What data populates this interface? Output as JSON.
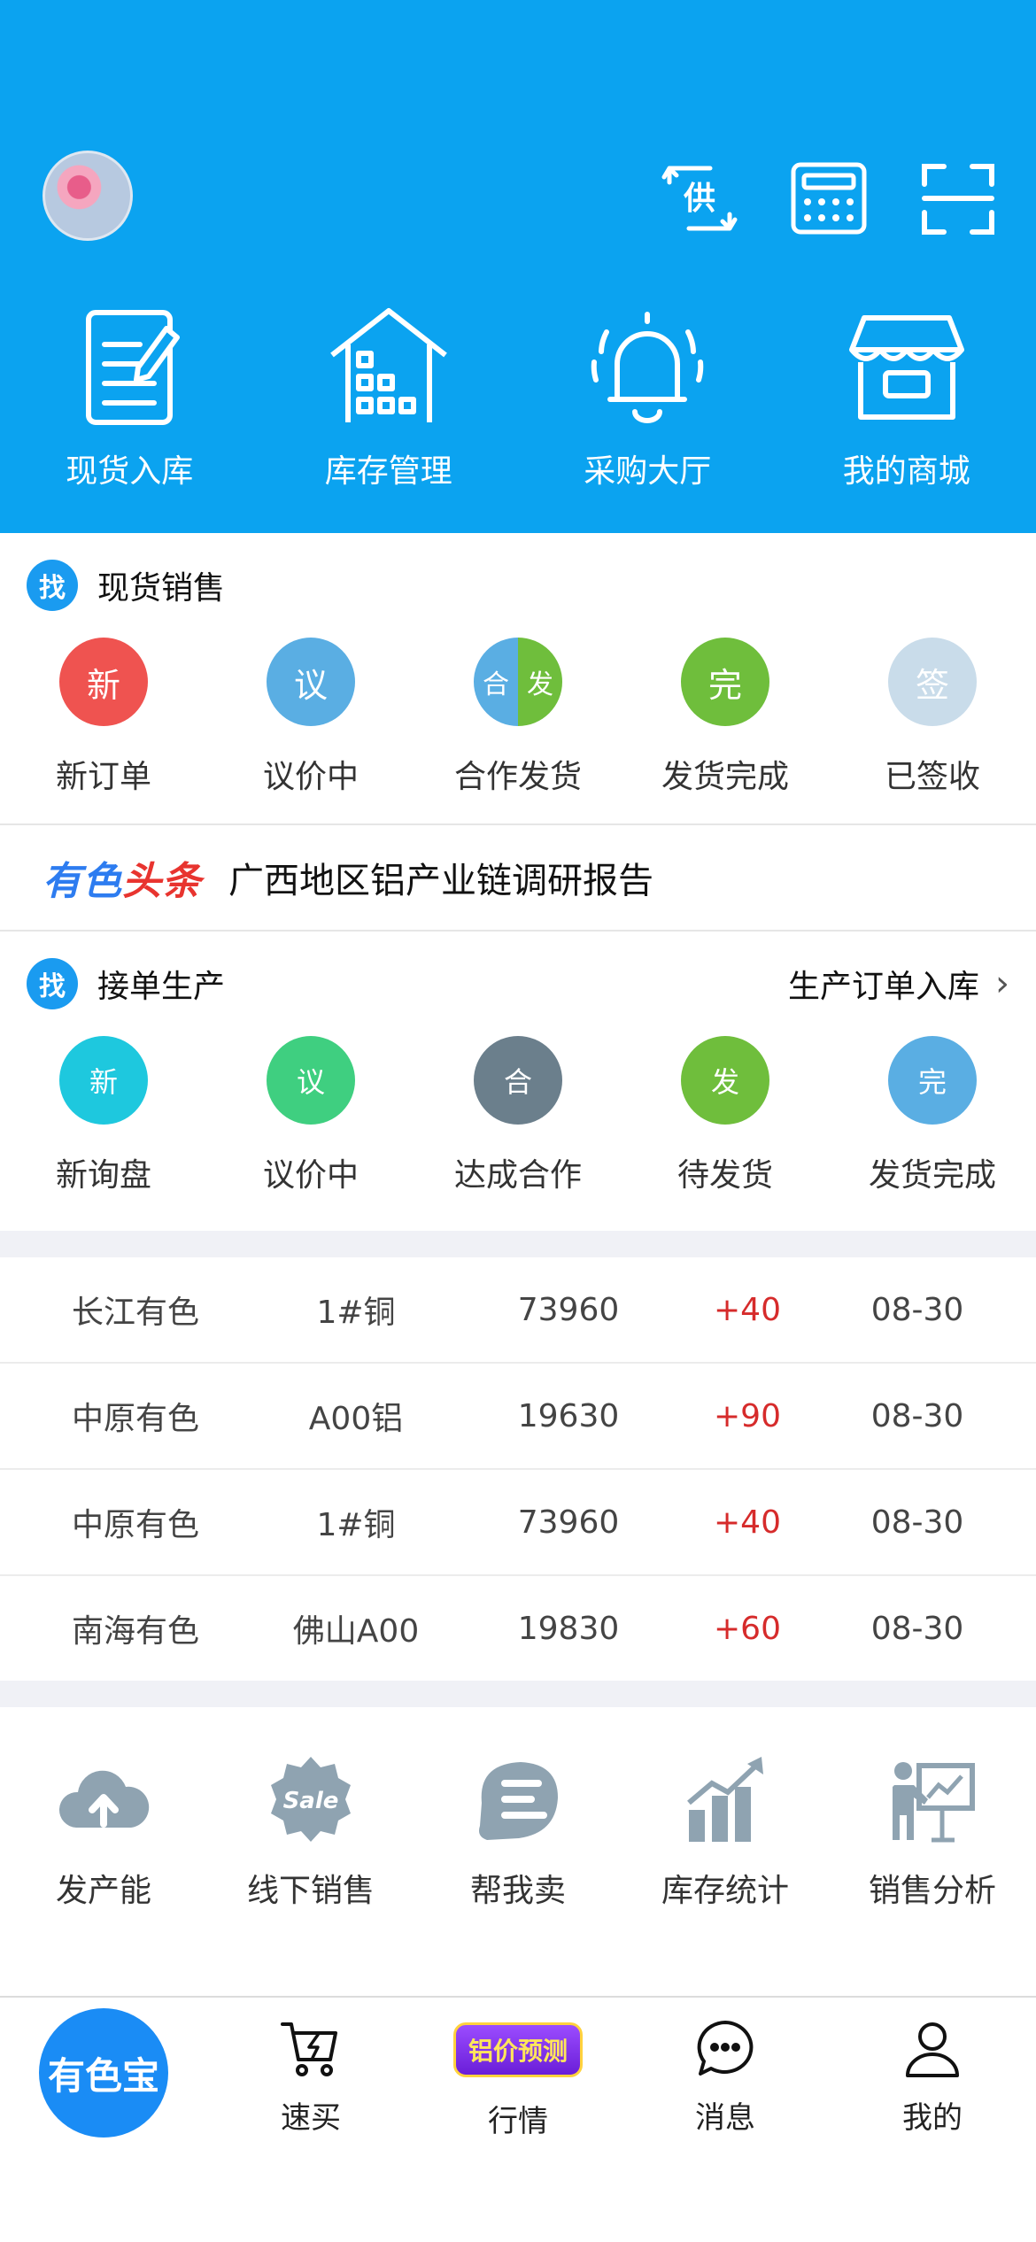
{
  "header": {
    "top_icons": [
      {
        "name": "supply-icon",
        "glyph": "供"
      },
      {
        "name": "calculator-icon"
      },
      {
        "name": "scan-icon"
      }
    ],
    "quick_actions": [
      {
        "label": "现货入库",
        "icon": "document-edit-icon"
      },
      {
        "label": "库存管理",
        "icon": "warehouse-icon"
      },
      {
        "label": "采购大厅",
        "icon": "bell-icon"
      },
      {
        "label": "我的商城",
        "icon": "shop-icon"
      }
    ]
  },
  "spot_sales": {
    "badge": "找",
    "title": "现货销售",
    "statuses": [
      {
        "glyph": "新",
        "label": "新订单",
        "color": "#ef5350"
      },
      {
        "glyph": "议",
        "label": "议价中",
        "color": "#5aaee3"
      },
      {
        "glyph_left": "合",
        "glyph_right": "发",
        "label": "合作发货",
        "color_left": "#5aaee3",
        "color_right": "#6fbe3c"
      },
      {
        "glyph": "完",
        "label": "发货完成",
        "color": "#6fbe3c"
      },
      {
        "glyph": "签",
        "label": "已签收",
        "color": "#c9dcea"
      }
    ]
  },
  "news": {
    "brand_part1": "有色",
    "brand_part2": "头条",
    "headline": "广西地区铝产业链调研报告"
  },
  "production": {
    "badge": "找",
    "title": "接单生产",
    "link": "生产订单入库",
    "statuses": [
      {
        "glyph": "新",
        "label": "新询盘",
        "color": "#1ec8de"
      },
      {
        "glyph": "议",
        "label": "议价中",
        "color": "#3fcf80"
      },
      {
        "glyph": "合",
        "label": "达成合作",
        "color": "#6b7f8c"
      },
      {
        "glyph": "发",
        "label": "待发货",
        "color": "#6fbe3c"
      },
      {
        "glyph": "完",
        "label": "发货完成",
        "color": "#5aaee3"
      }
    ]
  },
  "prices": [
    {
      "market": "长江有色",
      "product": "1#铜",
      "price": "73960",
      "change": "+40",
      "date": "08-30"
    },
    {
      "market": "中原有色",
      "product": "A00铝",
      "price": "19630",
      "change": "+90",
      "date": "08-30"
    },
    {
      "market": "中原有色",
      "product": "1#铜",
      "price": "73960",
      "change": "+40",
      "date": "08-30"
    },
    {
      "market": "南海有色",
      "product": "佛山A00",
      "price": "19830",
      "change": "+60",
      "date": "08-30"
    }
  ],
  "tools": [
    {
      "label": "发产能",
      "icon": "cloud-upload-icon"
    },
    {
      "label": "线下销售",
      "icon": "sale-badge-icon",
      "badge_text": "Sale"
    },
    {
      "label": "帮我卖",
      "icon": "hand-help-icon"
    },
    {
      "label": "库存统计",
      "icon": "bar-chart-icon"
    },
    {
      "label": "销售分析",
      "icon": "presentation-icon"
    }
  ],
  "tabbar": {
    "home": "有色宝",
    "buy": "速买",
    "promo": "铝价预测",
    "market": "行情",
    "messages": "消息",
    "me": "我的"
  },
  "colors": {
    "header_bg": "#0ba3f0",
    "accent_blue": "#1a9bf0",
    "price_up": "#d62b2b",
    "news_brand_blue": "#2d7cf0",
    "news_brand_red": "#e8342f"
  }
}
